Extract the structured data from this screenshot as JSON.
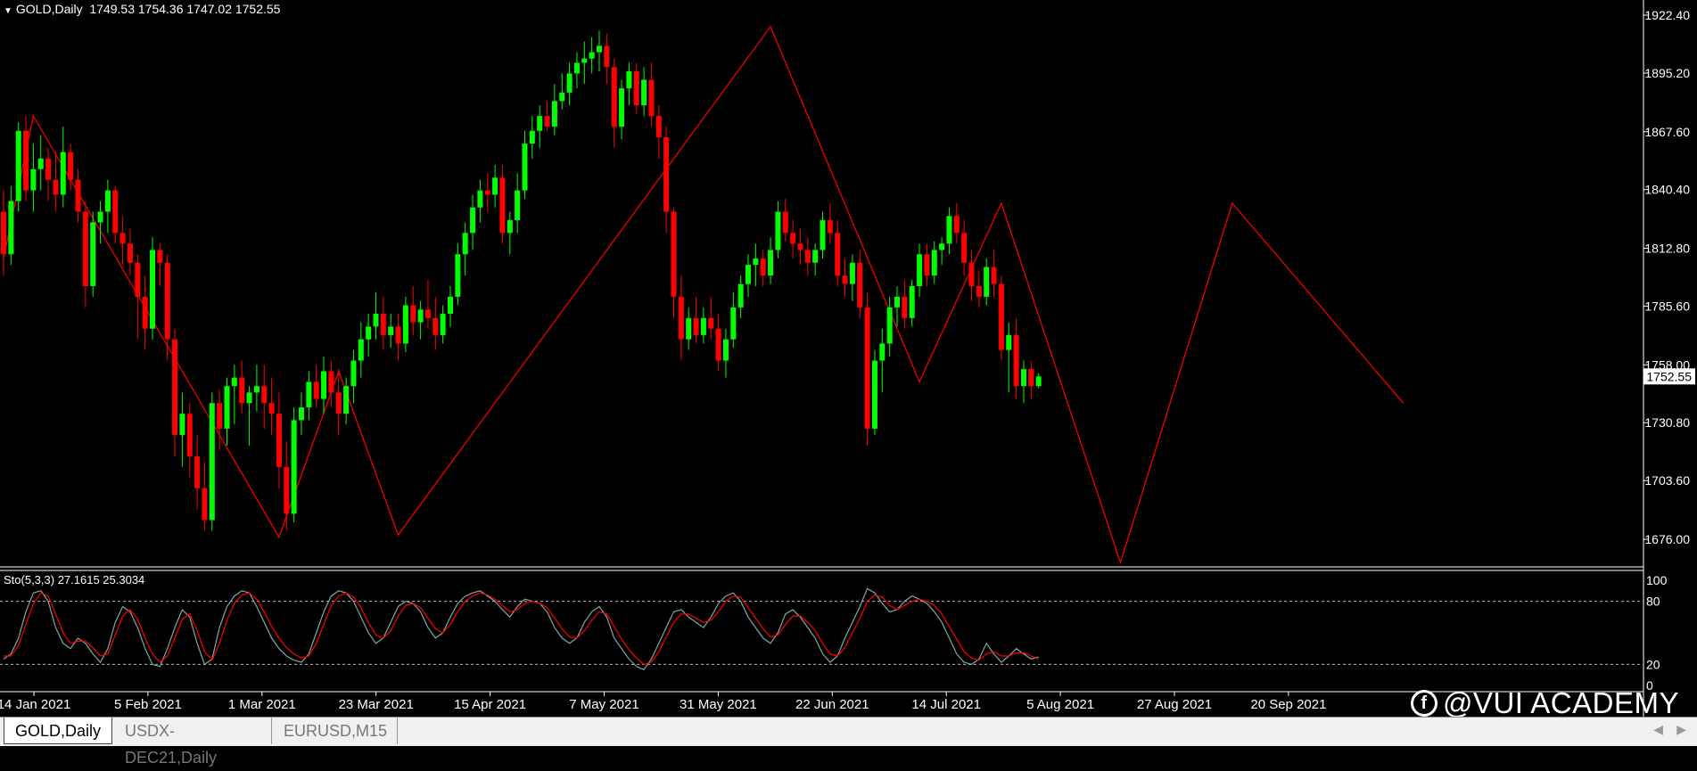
{
  "window": {
    "symbol_label": "GOLD,Daily",
    "ohlc": "1749.53 1754.36 1747.02 1752.55"
  },
  "price_axis": {
    "labels": [
      "1922.40",
      "1895.20",
      "1867.60",
      "1840.40",
      "1812.80",
      "1785.60",
      "1758.00",
      "1730.80",
      "1703.60",
      "1676.00"
    ],
    "current_price": "1752.55"
  },
  "indicator": {
    "title": "Sto(5,3,3) 27.1615 25.3034",
    "levels": [
      "100",
      "80",
      "20",
      "0"
    ]
  },
  "time_axis": {
    "labels": [
      "14 Jan 2021",
      "5 Feb 2021",
      "1 Mar 2021",
      "23 Mar 2021",
      "15 Apr 2021",
      "7 May 2021",
      "31 May 2021",
      "22 Jun 2021",
      "14 Jul 2021",
      "5 Aug 2021",
      "27 Aug 2021",
      "20 Sep 2021"
    ]
  },
  "watermark": {
    "logo_glyph": "f",
    "text": "@VUI ACADEMY"
  },
  "tabs": [
    {
      "label": "GOLD,Daily",
      "active": true
    },
    {
      "label": "USDX-DEC21,Daily",
      "active": false
    },
    {
      "label": "EURUSD,M15",
      "active": false
    }
  ],
  "colors": {
    "background": "#000000",
    "bull": "#00ff00",
    "bear": "#ff0000",
    "zigzag": "#ff0000",
    "sto_main": "#7fa9a6",
    "sto_signal": "#ff0000",
    "text": "#ffffff"
  },
  "chart_data": [
    {
      "type": "candlestick",
      "title": "GOLD,Daily",
      "ylim": [
        1664,
        1929
      ],
      "start_date": "2021-01-08",
      "zigzag_points": [
        {
          "date": "2021-01-08",
          "price": 1808
        },
        {
          "date": "2021-01-14",
          "price": 1875
        },
        {
          "date": "2021-03-01",
          "price": 1677
        },
        {
          "date": "2021-03-12",
          "price": 1755
        },
        {
          "date": "2021-03-23",
          "price": 1678
        },
        {
          "date": "2021-06-01",
          "price": 1917
        },
        {
          "date": "2021-06-29",
          "price": 1750
        },
        {
          "date": "2021-07-14",
          "price": 1834
        },
        {
          "date": "2021-08-06",
          "price": 1665
        },
        {
          "date": "2021-08-27",
          "price": 1834
        },
        {
          "date": "2021-09-28",
          "price": 1740
        }
      ],
      "ohlc": [
        [
          1830,
          1840,
          1800,
          1810
        ],
        [
          1810,
          1842,
          1805,
          1835
        ],
        [
          1835,
          1872,
          1830,
          1868
        ],
        [
          1868,
          1875,
          1835,
          1840
        ],
        [
          1840,
          1862,
          1830,
          1850
        ],
        [
          1850,
          1866,
          1840,
          1855
        ],
        [
          1855,
          1860,
          1835,
          1845
        ],
        [
          1845,
          1858,
          1830,
          1838
        ],
        [
          1838,
          1870,
          1832,
          1858
        ],
        [
          1858,
          1862,
          1840,
          1845
        ],
        [
          1845,
          1850,
          1825,
          1830
        ],
        [
          1830,
          1835,
          1785,
          1795
        ],
        [
          1795,
          1830,
          1790,
          1825
        ],
        [
          1825,
          1835,
          1815,
          1830
        ],
        [
          1830,
          1845,
          1820,
          1840
        ],
        [
          1840,
          1842,
          1815,
          1820
        ],
        [
          1820,
          1828,
          1805,
          1815
        ],
        [
          1815,
          1822,
          1800,
          1806
        ],
        [
          1806,
          1810,
          1770,
          1790
        ],
        [
          1790,
          1800,
          1765,
          1775
        ],
        [
          1775,
          1818,
          1770,
          1812
        ],
        [
          1812,
          1815,
          1795,
          1806
        ],
        [
          1806,
          1810,
          1760,
          1770
        ],
        [
          1770,
          1775,
          1715,
          1725
        ],
        [
          1725,
          1745,
          1710,
          1735
        ],
        [
          1735,
          1740,
          1705,
          1715
        ],
        [
          1715,
          1725,
          1690,
          1700
        ],
        [
          1700,
          1712,
          1680,
          1685
        ],
        [
          1685,
          1745,
          1680,
          1740
        ],
        [
          1740,
          1746,
          1718,
          1728
        ],
        [
          1728,
          1752,
          1720,
          1748
        ],
        [
          1748,
          1758,
          1730,
          1752
        ],
        [
          1752,
          1760,
          1735,
          1740
        ],
        [
          1740,
          1748,
          1720,
          1745
        ],
        [
          1745,
          1758,
          1736,
          1748
        ],
        [
          1748,
          1758,
          1728,
          1740
        ],
        [
          1740,
          1752,
          1725,
          1735
        ],
        [
          1735,
          1745,
          1700,
          1710
        ],
        [
          1710,
          1722,
          1680,
          1688
        ],
        [
          1688,
          1738,
          1684,
          1732
        ],
        [
          1732,
          1745,
          1725,
          1738
        ],
        [
          1738,
          1755,
          1732,
          1750
        ],
        [
          1750,
          1758,
          1738,
          1742
        ],
        [
          1742,
          1762,
          1735,
          1755
        ],
        [
          1755,
          1760,
          1738,
          1745
        ],
        [
          1745,
          1756,
          1725,
          1735
        ],
        [
          1735,
          1752,
          1730,
          1748
        ],
        [
          1748,
          1765,
          1740,
          1760
        ],
        [
          1760,
          1778,
          1752,
          1770
        ],
        [
          1770,
          1782,
          1762,
          1776
        ],
        [
          1776,
          1792,
          1770,
          1782
        ],
        [
          1782,
          1790,
          1765,
          1772
        ],
        [
          1772,
          1782,
          1766,
          1776
        ],
        [
          1776,
          1782,
          1760,
          1768
        ],
        [
          1768,
          1790,
          1764,
          1786
        ],
        [
          1786,
          1795,
          1772,
          1778
        ],
        [
          1778,
          1788,
          1770,
          1784
        ],
        [
          1784,
          1798,
          1775,
          1780
        ],
        [
          1780,
          1790,
          1765,
          1772
        ],
        [
          1772,
          1786,
          1768,
          1782
        ],
        [
          1782,
          1795,
          1776,
          1790
        ],
        [
          1790,
          1815,
          1786,
          1810
        ],
        [
          1810,
          1825,
          1800,
          1820
        ],
        [
          1820,
          1838,
          1812,
          1832
        ],
        [
          1832,
          1845,
          1825,
          1840
        ],
        [
          1840,
          1848,
          1830,
          1838
        ],
        [
          1838,
          1852,
          1832,
          1846
        ],
        [
          1846,
          1852,
          1815,
          1820
        ],
        [
          1820,
          1830,
          1810,
          1826
        ],
        [
          1826,
          1848,
          1820,
          1840
        ],
        [
          1840,
          1868,
          1836,
          1862
        ],
        [
          1862,
          1875,
          1855,
          1868
        ],
        [
          1868,
          1880,
          1860,
          1875
        ],
        [
          1875,
          1882,
          1868,
          1870
        ],
        [
          1870,
          1890,
          1866,
          1882
        ],
        [
          1882,
          1895,
          1878,
          1886
        ],
        [
          1886,
          1900,
          1880,
          1895
        ],
        [
          1895,
          1905,
          1888,
          1900
        ],
        [
          1900,
          1910,
          1890,
          1902
        ],
        [
          1902,
          1912,
          1895,
          1905
        ],
        [
          1905,
          1915,
          1896,
          1908
        ],
        [
          1908,
          1914,
          1890,
          1898
        ],
        [
          1898,
          1902,
          1860,
          1870
        ],
        [
          1870,
          1892,
          1864,
          1888
        ],
        [
          1888,
          1900,
          1880,
          1896
        ],
        [
          1896,
          1900,
          1876,
          1880
        ],
        [
          1880,
          1898,
          1875,
          1892
        ],
        [
          1892,
          1900,
          1870,
          1875
        ],
        [
          1875,
          1880,
          1855,
          1865
        ],
        [
          1865,
          1870,
          1820,
          1830
        ],
        [
          1830,
          1832,
          1780,
          1790
        ],
        [
          1790,
          1800,
          1760,
          1770
        ],
        [
          1770,
          1785,
          1765,
          1780
        ],
        [
          1780,
          1790,
          1768,
          1772
        ],
        [
          1772,
          1785,
          1768,
          1780
        ],
        [
          1780,
          1790,
          1770,
          1775
        ],
        [
          1775,
          1782,
          1755,
          1760
        ],
        [
          1760,
          1775,
          1752,
          1770
        ],
        [
          1770,
          1792,
          1766,
          1785
        ],
        [
          1785,
          1800,
          1780,
          1796
        ],
        [
          1796,
          1810,
          1790,
          1805
        ],
        [
          1805,
          1815,
          1795,
          1808
        ],
        [
          1808,
          1812,
          1795,
          1800
        ],
        [
          1800,
          1818,
          1796,
          1812
        ],
        [
          1812,
          1835,
          1808,
          1830
        ],
        [
          1830,
          1836,
          1816,
          1820
        ],
        [
          1820,
          1826,
          1808,
          1815
        ],
        [
          1815,
          1822,
          1805,
          1812
        ],
        [
          1812,
          1818,
          1800,
          1806
        ],
        [
          1806,
          1815,
          1800,
          1812
        ],
        [
          1812,
          1830,
          1808,
          1826
        ],
        [
          1826,
          1834,
          1815,
          1820
        ],
        [
          1820,
          1826,
          1795,
          1800
        ],
        [
          1800,
          1808,
          1790,
          1796
        ],
        [
          1796,
          1810,
          1788,
          1806
        ],
        [
          1806,
          1812,
          1780,
          1785
        ],
        [
          1785,
          1792,
          1720,
          1728
        ],
        [
          1728,
          1765,
          1725,
          1760
        ],
        [
          1760,
          1775,
          1745,
          1768
        ],
        [
          1768,
          1790,
          1762,
          1785
        ],
        [
          1785,
          1795,
          1776,
          1790
        ],
        [
          1790,
          1798,
          1775,
          1780
        ],
        [
          1780,
          1798,
          1776,
          1795
        ],
        [
          1795,
          1815,
          1790,
          1810
        ],
        [
          1810,
          1815,
          1795,
          1800
        ],
        [
          1800,
          1816,
          1796,
          1812
        ],
        [
          1812,
          1818,
          1805,
          1815
        ],
        [
          1815,
          1832,
          1810,
          1828
        ],
        [
          1828,
          1834,
          1815,
          1820
        ],
        [
          1820,
          1826,
          1800,
          1806
        ],
        [
          1806,
          1812,
          1788,
          1795
        ],
        [
          1795,
          1802,
          1785,
          1790
        ],
        [
          1790,
          1808,
          1786,
          1804
        ],
        [
          1804,
          1812,
          1790,
          1796
        ],
        [
          1796,
          1800,
          1760,
          1765
        ],
        [
          1765,
          1778,
          1745,
          1772
        ],
        [
          1772,
          1780,
          1742,
          1748
        ],
        [
          1748,
          1760,
          1740,
          1756
        ],
        [
          1756,
          1760,
          1742,
          1748
        ],
        [
          1748,
          1754,
          1747,
          1752.55
        ]
      ]
    },
    {
      "type": "line",
      "title": "Sto(5,3,3) 27.1615 25.3034",
      "ylim": [
        0,
        100
      ],
      "levels": [
        20,
        80
      ],
      "series": [
        {
          "values": [
            25,
            30,
            45,
            70,
            88,
            90,
            80,
            55,
            40,
            35,
            45,
            40,
            30,
            22,
            35,
            60,
            75,
            70,
            55,
            35,
            20,
            18,
            35,
            55,
            72,
            65,
            40,
            20,
            25,
            55,
            75,
            85,
            90,
            88,
            75,
            60,
            45,
            35,
            28,
            24,
            22,
            30,
            50,
            70,
            85,
            90,
            88,
            80,
            65,
            50,
            40,
            45,
            60,
            75,
            80,
            78,
            70,
            55,
            45,
            50,
            65,
            78,
            85,
            88,
            90,
            85,
            80,
            72,
            65,
            75,
            82,
            80,
            78,
            70,
            55,
            45,
            40,
            45,
            60,
            70,
            75,
            65,
            45,
            35,
            25,
            18,
            15,
            25,
            40,
            55,
            70,
            72,
            65,
            60,
            55,
            65,
            78,
            85,
            88,
            80,
            65,
            55,
            45,
            40,
            50,
            68,
            72,
            65,
            55,
            45,
            30,
            22,
            28,
            45,
            60,
            75,
            92,
            88,
            78,
            70,
            72,
            80,
            85,
            82,
            78,
            70,
            60,
            45,
            30,
            22,
            20,
            25,
            40,
            30,
            22,
            28,
            35,
            30,
            25,
            27
          ]
        },
        {
          "values": [
            28,
            28,
            38,
            58,
            78,
            88,
            85,
            68,
            50,
            40,
            42,
            42,
            36,
            28,
            30,
            48,
            66,
            72,
            63,
            45,
            30,
            22,
            28,
            45,
            63,
            68,
            52,
            32,
            24,
            40,
            62,
            78,
            86,
            88,
            82,
            70,
            56,
            45,
            36,
            30,
            26,
            28,
            40,
            58,
            76,
            85,
            88,
            84,
            74,
            60,
            48,
            45,
            52,
            66,
            76,
            78,
            74,
            64,
            54,
            50,
            58,
            70,
            80,
            85,
            88,
            86,
            82,
            76,
            70,
            72,
            78,
            80,
            78,
            74,
            64,
            54,
            46,
            45,
            52,
            62,
            70,
            68,
            56,
            44,
            34,
            26,
            20,
            22,
            32,
            46,
            60,
            68,
            68,
            64,
            60,
            62,
            70,
            80,
            85,
            84,
            74,
            64,
            54,
            46,
            48,
            58,
            66,
            66,
            60,
            52,
            40,
            30,
            28,
            36,
            50,
            64,
            80,
            86,
            84,
            76,
            72,
            76,
            80,
            82,
            80,
            76,
            68,
            56,
            44,
            32,
            26,
            24,
            30,
            32,
            28,
            28,
            31,
            31,
            28,
            25
          ]
        }
      ]
    }
  ]
}
